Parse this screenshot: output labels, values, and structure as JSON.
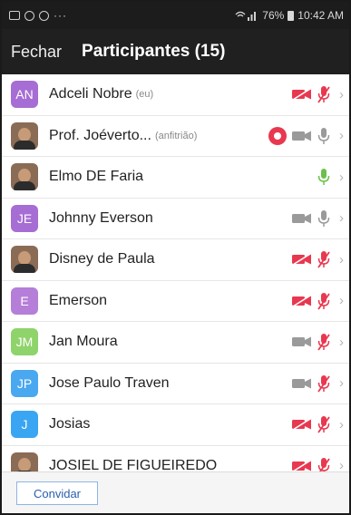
{
  "status_bar": {
    "dots": "···",
    "battery": "76%",
    "time": "10:42 AM"
  },
  "header": {
    "close_label": "Fechar",
    "title": "Participantes (15)"
  },
  "participants": [
    {
      "initials": "AN",
      "avatar_color": "#a66dd4",
      "name": "Adceli Nobre",
      "tag": "(eu)",
      "video": "off",
      "mic": "off",
      "recording": false
    },
    {
      "initials": "",
      "avatar_color": "photo",
      "name": "Prof. Joéverto...",
      "tag": "(anfitrião)",
      "video": "on",
      "mic": "on",
      "recording": true
    },
    {
      "initials": "",
      "avatar_color": "photo",
      "name": "Elmo DE Faria",
      "tag": "",
      "video": "none",
      "mic": "speaking",
      "recording": false
    },
    {
      "initials": "JE",
      "avatar_color": "#a66dd4",
      "name": "Johnny Everson",
      "tag": "",
      "video": "on",
      "mic": "on",
      "recording": false
    },
    {
      "initials": "",
      "avatar_color": "photo",
      "name": "Disney de Paula",
      "tag": "",
      "video": "off",
      "mic": "off",
      "recording": false
    },
    {
      "initials": "E",
      "avatar_color": "#b57ed8",
      "name": "Emerson",
      "tag": "",
      "video": "off",
      "mic": "off",
      "recording": false
    },
    {
      "initials": "JM",
      "avatar_color": "#8fd36b",
      "name": "Jan Moura",
      "tag": "",
      "video": "on",
      "mic": "off",
      "recording": false
    },
    {
      "initials": "JP",
      "avatar_color": "#4aa8f0",
      "name": "Jose Paulo Traven",
      "tag": "",
      "video": "on",
      "mic": "off",
      "recording": false
    },
    {
      "initials": "J",
      "avatar_color": "#3aa5f2",
      "name": "Josias",
      "tag": "",
      "video": "off",
      "mic": "off",
      "recording": false
    },
    {
      "initials": "",
      "avatar_color": "photo",
      "name": "JOSIEL DE FIGUEIREDO",
      "tag": "",
      "video": "off",
      "mic": "off",
      "recording": false
    }
  ],
  "footer": {
    "invite_label": "Convidar"
  },
  "colors": {
    "muted_red": "#e8384f",
    "icon_gray": "#9a9a9a",
    "speaking_green": "#6cc04a",
    "record_red": "#e8384f"
  }
}
